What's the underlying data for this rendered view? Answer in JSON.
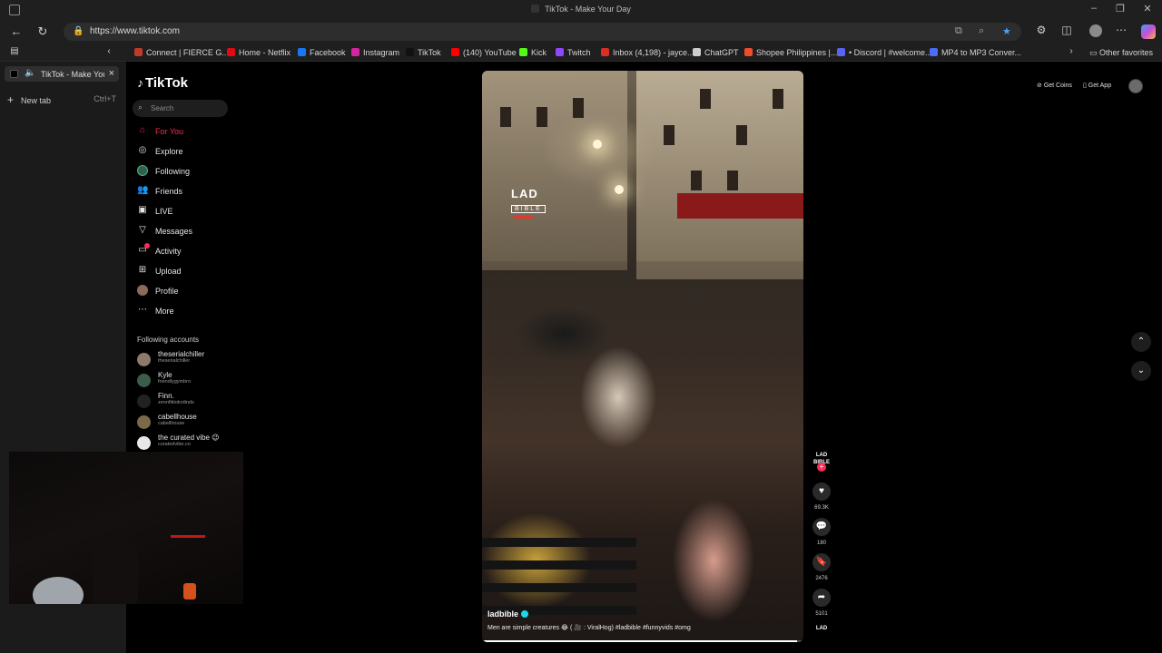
{
  "window": {
    "title": "TikTok - Make Your Day"
  },
  "browser": {
    "url_host": "https://www.tiktok.com",
    "bookmarks": [
      {
        "label": "Connect | FIERCE G...",
        "color": "#c0392b"
      },
      {
        "label": "Home - Netflix",
        "color": "#e50914"
      },
      {
        "label": "Facebook",
        "color": "#1877f2"
      },
      {
        "label": "Instagram",
        "color": "#d6249f"
      },
      {
        "label": "TikTok",
        "color": "#111111"
      },
      {
        "label": "(140) YouTube",
        "color": "#ff0000"
      },
      {
        "label": "Kick",
        "color": "#53fc18"
      },
      {
        "label": "Twitch",
        "color": "#9146ff"
      },
      {
        "label": "Inbox (4,198) - jayce...",
        "color": "#d93025"
      },
      {
        "label": "ChatGPT",
        "color": "#cccccc"
      },
      {
        "label": "Shopee Philippines |...",
        "color": "#ee4d2d"
      },
      {
        "label": "• Discord | #welcome...",
        "color": "#5865f2"
      },
      {
        "label": "MP4 to MP3 Conver...",
        "color": "#4a6cf7"
      }
    ],
    "other_favorites": "Other favorites",
    "tab": {
      "label": "TikTok - Make Your Day"
    },
    "new_tab": {
      "label": "New tab",
      "shortcut": "Ctrl+T"
    }
  },
  "tiktok": {
    "logo": "TikTok",
    "search_placeholder": "Search",
    "nav": [
      {
        "label": "For You",
        "icon": "home-icon",
        "active": true
      },
      {
        "label": "Explore",
        "icon": "compass-icon"
      },
      {
        "label": "Following",
        "icon": "following-icon"
      },
      {
        "label": "Friends",
        "icon": "friends-icon"
      },
      {
        "label": "LIVE",
        "icon": "live-icon"
      },
      {
        "label": "Messages",
        "icon": "messages-icon"
      },
      {
        "label": "Activity",
        "icon": "activity-icon"
      },
      {
        "label": "Upload",
        "icon": "upload-icon"
      },
      {
        "label": "Profile",
        "icon": "profile-icon"
      },
      {
        "label": "More",
        "icon": "more-icon"
      }
    ],
    "following_title": "Following accounts",
    "accounts": [
      {
        "name": "theserialchiller",
        "handle": "theserialchiller",
        "color": "#8c7a6a"
      },
      {
        "name": "Kyle",
        "handle": "friendlygymbro",
        "color": "#3b5c4a"
      },
      {
        "name": "Finn.",
        "handle": "zennfiktokrdinds",
        "color": "#222222"
      },
      {
        "name": "cabellhouse",
        "handle": "cabellhouse",
        "color": "#7a6a4a"
      },
      {
        "name": "the curated vibe 😉",
        "handle": "curatedvibe.co",
        "color": "#e8e8e8"
      }
    ],
    "top_right": {
      "coins": "Get Coins",
      "app": "Get App"
    },
    "video": {
      "author": "ladbible",
      "description": "Men are simple creatures 😂 ( 🎥 : ViralHog) #ladbible #funnyvids #omg",
      "watermark_line1": "LAD",
      "watermark_line2": "BIBLE",
      "progress": 0.98
    },
    "actions": {
      "creator_badge": "LAD BIBLE",
      "likes": "69.3K",
      "comments": "180",
      "saves": "2476",
      "shares": "5101"
    }
  }
}
